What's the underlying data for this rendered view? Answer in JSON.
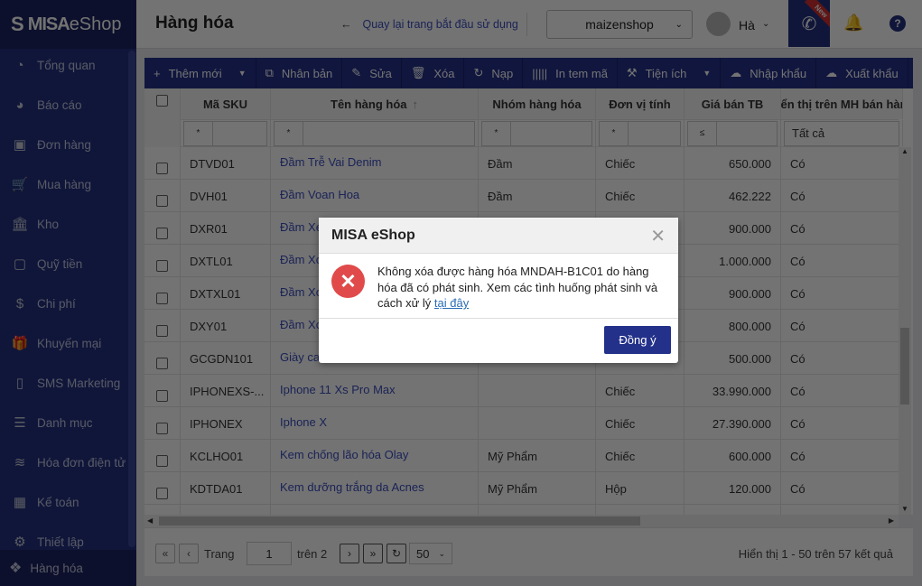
{
  "app": {
    "logo_brand": "MISA",
    "logo_product": "eShop",
    "page_title": "Hàng hóa",
    "back_link": "Quay lại trang bắt đầu sử dụng",
    "shop": "maizenshop",
    "user": "Hà",
    "new_badge": "New"
  },
  "sidebar": {
    "items": [
      {
        "label": "Tổng quan",
        "icon": "dashboard-icon",
        "glyph": "◔"
      },
      {
        "label": "Báo cáo",
        "icon": "pie-chart-icon",
        "glyph": "◕"
      },
      {
        "label": "Đơn hàng",
        "icon": "delivery-truck-icon",
        "glyph": "▣"
      },
      {
        "label": "Mua hàng",
        "icon": "cart-icon",
        "glyph": "🛒"
      },
      {
        "label": "Kho",
        "icon": "warehouse-icon",
        "glyph": "🏛"
      },
      {
        "label": "Quỹ tiền",
        "icon": "safe-icon",
        "glyph": "▢"
      },
      {
        "label": "Chi phí",
        "icon": "money-bag-icon",
        "glyph": "$"
      },
      {
        "label": "Khuyến mại",
        "icon": "gift-icon",
        "glyph": "🎁"
      },
      {
        "label": "SMS Marketing",
        "icon": "phone-icon",
        "glyph": "▯"
      },
      {
        "label": "Danh mục",
        "icon": "list-icon",
        "glyph": "☰"
      },
      {
        "label": "Hóa đơn điện tử",
        "icon": "invoice-icon",
        "glyph": "≋"
      },
      {
        "label": "Kế toán",
        "icon": "calculator-icon",
        "glyph": "▦"
      },
      {
        "label": "Thiết lập",
        "icon": "gear-icon",
        "glyph": "⚙"
      }
    ],
    "footer": {
      "label": "Hàng hóa",
      "icon": "boxes-icon",
      "glyph": "❖"
    }
  },
  "toolbar": [
    {
      "label": "Thêm mới",
      "icon": "plus-icon",
      "glyph": "+",
      "dropdown": true
    },
    {
      "label": "Nhân bản",
      "icon": "copy-icon",
      "glyph": "⧉"
    },
    {
      "label": "Sửa",
      "icon": "pencil-icon",
      "glyph": "✎"
    },
    {
      "label": "Xóa",
      "icon": "trash-icon",
      "glyph": "🗑"
    },
    {
      "label": "Nạp",
      "icon": "refresh-icon",
      "glyph": "↻"
    },
    {
      "label": "In tem mã",
      "icon": "barcode-icon",
      "glyph": "|||||"
    },
    {
      "label": "Tiện ích",
      "icon": "tools-icon",
      "glyph": "⚒",
      "dropdown": true
    },
    {
      "label": "Nhập khẩu",
      "icon": "cloud-upload-icon",
      "glyph": "☁"
    },
    {
      "label": "Xuất khẩu",
      "icon": "cloud-download-icon",
      "glyph": "☁"
    }
  ],
  "table": {
    "columns": [
      "Mã SKU",
      "Tên hàng hóa",
      "Nhóm hàng hóa",
      "Đơn vị tính",
      "Giá bán TB",
      "Hiển thị trên MH bán hàng"
    ],
    "sort_indicator": "↑",
    "filters": [
      "*",
      "*",
      "*",
      "*",
      "≤",
      "Tất cả"
    ],
    "rows": [
      [
        "DTVD01",
        "Đầm Trễ Vai Denim",
        "Đầm",
        "Chiếc",
        "650.000",
        "Có"
      ],
      [
        "DVH01",
        "Đầm Voan Hoa",
        "Đầm",
        "Chiếc",
        "462.222",
        "Có"
      ],
      [
        "DXR01",
        "Đầm Xe",
        "",
        "",
        "900.000",
        "Có"
      ],
      [
        "DXTL01",
        "Đầm Xo",
        "",
        "",
        "1.000.000",
        "Có"
      ],
      [
        "DXTXL01",
        "Đầm Xo",
        "",
        "",
        "900.000",
        "Có"
      ],
      [
        "DXY01",
        "Đầm Xo",
        "",
        "",
        "800.000",
        "Có"
      ],
      [
        "GCGDN101",
        "Giày ca",
        "",
        "",
        "500.000",
        "Có"
      ],
      [
        "IPHONEXS-...",
        "Iphone 11 Xs Pro Max",
        "",
        "Chiếc",
        "33.990.000",
        "Có"
      ],
      [
        "IPHONEX",
        "Iphone X",
        "",
        "Chiếc",
        "27.390.000",
        "Có"
      ],
      [
        "KCLHO01",
        "Kem chống lão hóa Olay",
        "Mỹ Phẩm",
        "Chiếc",
        "600.000",
        "Có"
      ],
      [
        "KDTDA01",
        "Kem dưỡng trắng da Acnes",
        "Mỹ Phẩm",
        "Hộp",
        "120.000",
        "Có"
      ]
    ]
  },
  "pager": {
    "page_label": "Trang",
    "page": "1",
    "of_label": "trên 2",
    "page_size": "50",
    "summary": "Hiển thị 1 - 50 trên 57 kết quả"
  },
  "dialog": {
    "title": "MISA eShop",
    "message": "Không xóa được hàng hóa MNDAH-B1C01 do hàng hóa đã có phát sinh. Xem các tình huống phát sinh và cách xử lý ",
    "link": "tại đây",
    "ok": "Đồng ý"
  }
}
